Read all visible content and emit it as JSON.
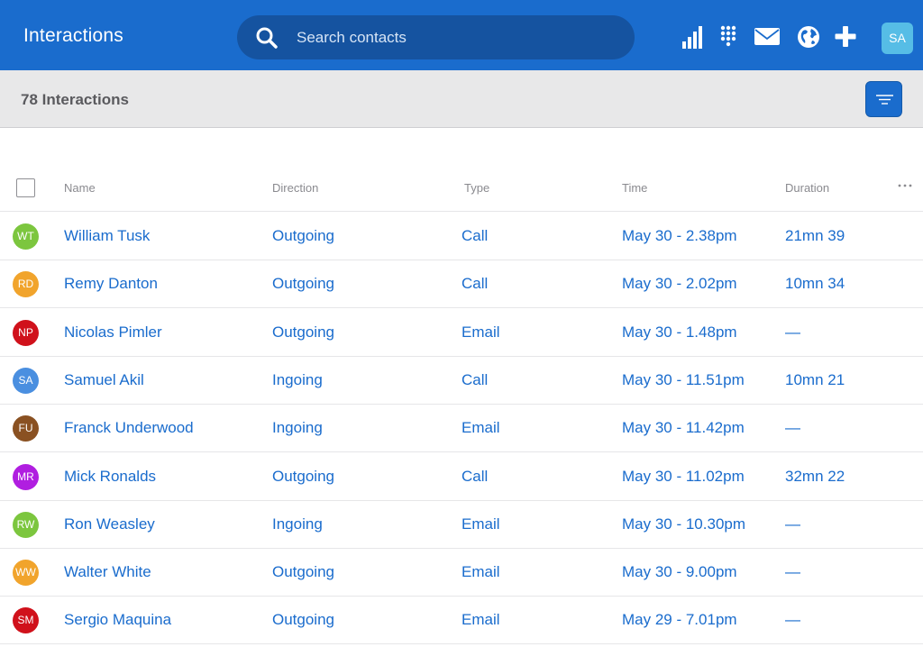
{
  "header": {
    "title": "Interactions",
    "search_placeholder": "Search contacts",
    "user_initials": "SA",
    "icons": [
      "stats-icon",
      "dialpad-icon",
      "mail-icon",
      "globe-icon",
      "plus-icon"
    ]
  },
  "subbar": {
    "count_label": "78 Interactions"
  },
  "table": {
    "columns": [
      "Name",
      "Direction",
      "Type",
      "Time",
      "Duration"
    ],
    "more_label": "···",
    "rows": [
      {
        "initials": "WT",
        "color": "#7cc63e",
        "name": "William Tusk",
        "direction": "Outgoing",
        "type": "Call",
        "time": "May 30 - 2.38pm",
        "duration": "21mn 39"
      },
      {
        "initials": "RD",
        "color": "#f1a42c",
        "name": "Remy Danton",
        "direction": "Outgoing",
        "type": "Call",
        "time": "May 30 - 2.02pm",
        "duration": "10mn 34"
      },
      {
        "initials": "NP",
        "color": "#d0111b",
        "name": "Nicolas Pimler",
        "direction": "Outgoing",
        "type": "Email",
        "time": "May 30 - 1.48pm",
        "duration": "—"
      },
      {
        "initials": "SA",
        "color": "#4a8fe0",
        "name": "Samuel Akil",
        "direction": "Ingoing",
        "type": "Call",
        "time": "May 30 - 11.51pm",
        "duration": "10mn 21"
      },
      {
        "initials": "FU",
        "color": "#8a5122",
        "name": "Franck Underwood",
        "direction": "Ingoing",
        "type": "Email",
        "time": "May 30 - 11.42pm",
        "duration": "—"
      },
      {
        "initials": "MR",
        "color": "#b01ee0",
        "name": "Mick Ronalds",
        "direction": "Outgoing",
        "type": "Call",
        "time": "May 30 - 11.02pm",
        "duration": "32mn 22"
      },
      {
        "initials": "RW",
        "color": "#7cc63e",
        "name": "Ron Weasley",
        "direction": "Ingoing",
        "type": "Email",
        "time": "May 30 - 10.30pm",
        "duration": "—"
      },
      {
        "initials": "WW",
        "color": "#f1a42c",
        "name": "Walter White",
        "direction": "Outgoing",
        "type": "Email",
        "time": "May 30 - 9.00pm",
        "duration": "—"
      },
      {
        "initials": "SM",
        "color": "#d0111b",
        "name": "Sergio Maquina",
        "direction": "Outgoing",
        "type": "Email",
        "time": "May 29 - 7.01pm",
        "duration": "—"
      }
    ]
  }
}
